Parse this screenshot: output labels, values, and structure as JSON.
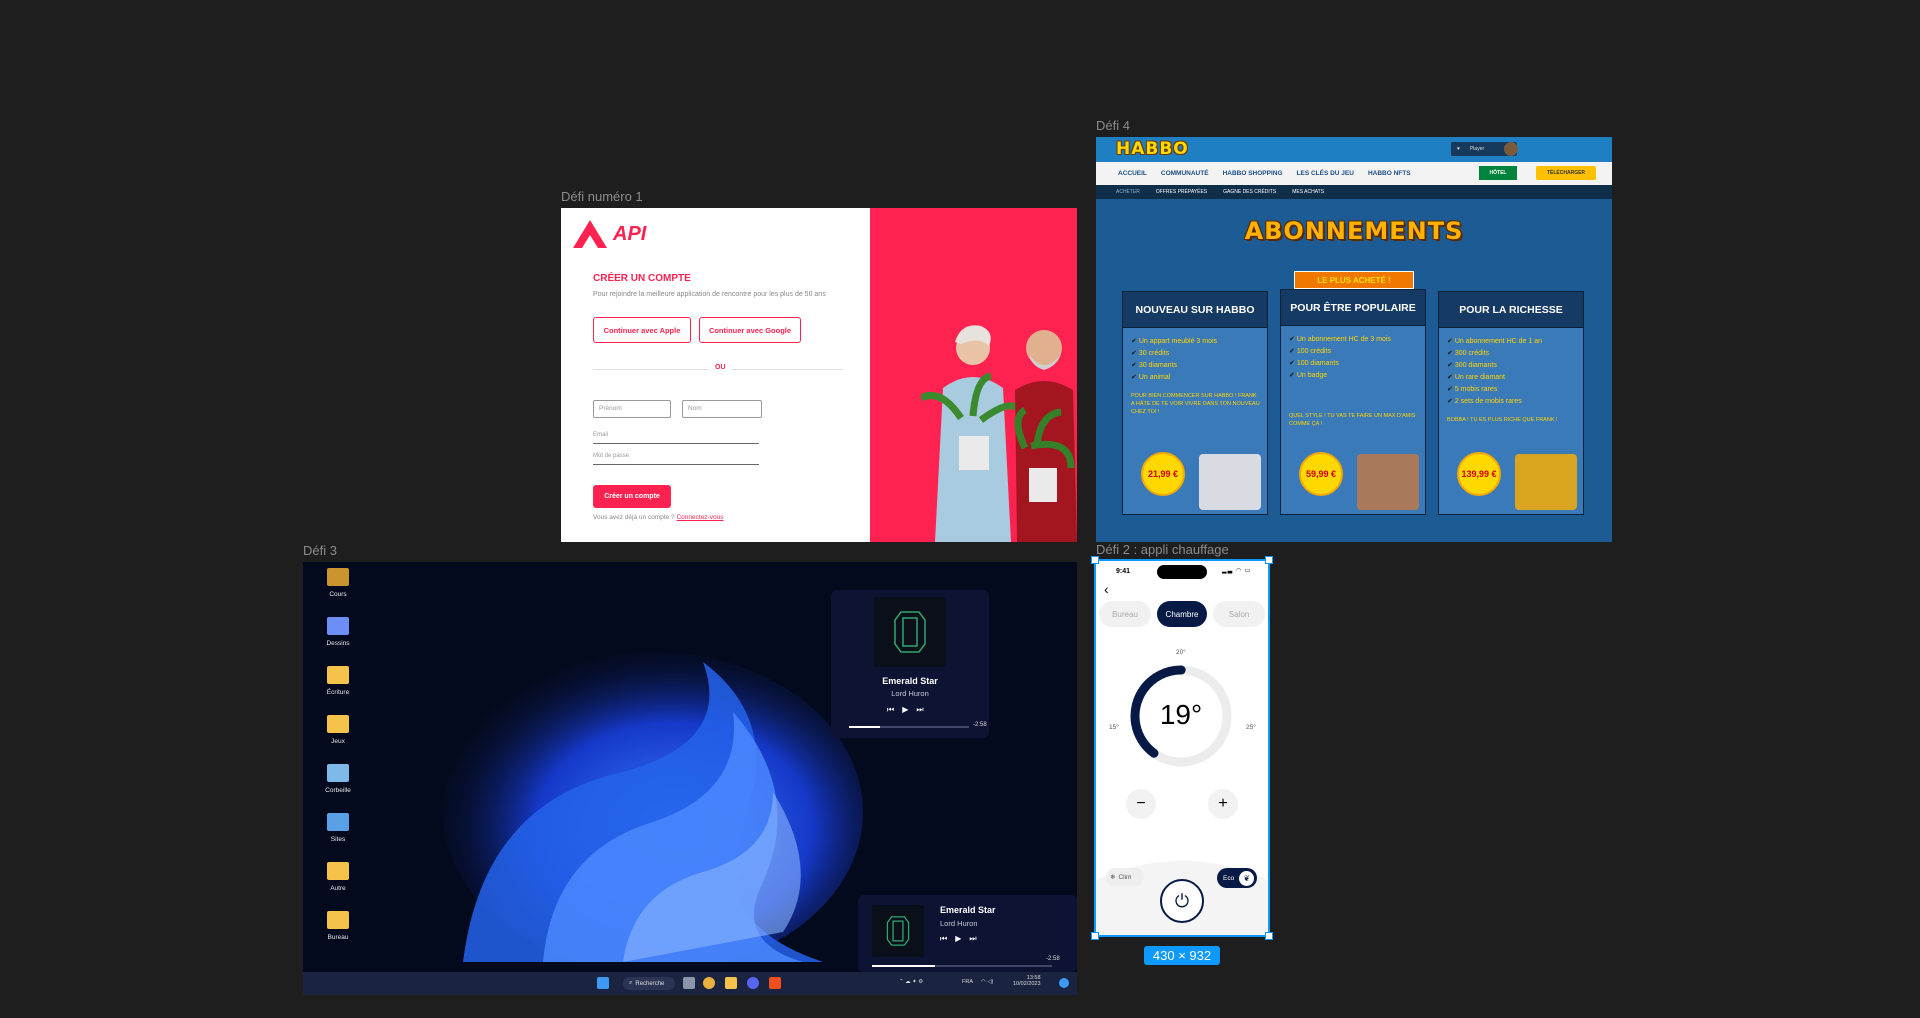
{
  "canvas": {
    "frames": {
      "defi1": {
        "label": "Défi numéro 1"
      },
      "defi4": {
        "label": "Défi 4"
      },
      "defi3": {
        "label": "Défi 3"
      },
      "defi2": {
        "label": "Défi 2 : appli chauffage"
      }
    },
    "selection_size_label": "430 × 932"
  },
  "defi1": {
    "logo": "API",
    "title": "CRÉER UN COMPTE",
    "subtitle": "Pour rejoindre la meilleure application de rencontre pour les plus de 50 ans",
    "apple_button": "Continuer avec Apple",
    "google_button": "Continuer avec Google",
    "divider_text": "OU",
    "firstname_placeholder": "Prénom",
    "lastname_placeholder": "Nom",
    "email_label": "Email",
    "password_label": "Mot de passe",
    "create_button": "Créer un compte",
    "have_account": "Vous avez déjà un compte ?",
    "login_link": "Connectez-vous",
    "accent_color": "#fe2251"
  },
  "defi4": {
    "logo": "HABBO",
    "user": "Player",
    "nav": [
      "ACCUEIL",
      "COMMUNAUTÉ",
      "HABBO SHOPPING",
      "LES CLÉS DU JEU",
      "HABBO NFTS"
    ],
    "hotel_button": "HÔTEL",
    "download_button": "TÉLÉCHARGER",
    "subnav": [
      "ACHETER",
      "OFFRES PRÉPAYÉES",
      "GAGNE DES CRÉDITS",
      "MES ACHATS"
    ],
    "heading": "ABONNEMENTS",
    "best_badge": "LE PLUS ACHETÉ !",
    "cards": [
      {
        "title": "NOUVEAU SUR HABBO",
        "items": [
          "Un appart meublé 3 mois",
          "30 crédits",
          "30 diamants",
          "Un animal"
        ],
        "blurb": "POUR BIEN COMMENCER SUR HABBO ! FRANK A HÂTE DE TE VOIR VIVRE DANS TON NOUVEAU CHEZ TOI !",
        "price": "21,99 €"
      },
      {
        "title": "POUR ÊTRE POPULAIRE",
        "items": [
          "Un abonnement HC de 3 mois",
          "100 crédits",
          "100 diamants",
          "Un badge"
        ],
        "blurb": "QUEL STYLE ! TU VAS TE FAIRE UN MAX D'AMIS COMME ÇA !",
        "price": "59,99 €"
      },
      {
        "title": "POUR LA RICHESSE",
        "items": [
          "Un abonnement HC de 1 an",
          "300 crédits",
          "300 diamants",
          "Un rare diamant",
          "5 mobis rares",
          "2 sets de mobis rares"
        ],
        "blurb": "BOBBA ! TU ES PLUS RICHE QUE FRANK !",
        "price": "139,99 €"
      }
    ]
  },
  "defi3": {
    "desktop_icons": [
      {
        "label": "Cours",
        "color": "#c9952c"
      },
      {
        "label": "Dessins",
        "color": "#6d8df7"
      },
      {
        "label": "Écriture",
        "color": "#f6c34a"
      },
      {
        "label": "Jeux",
        "color": "#f6c34a"
      },
      {
        "label": "Corbeille",
        "color": "#7fb9e8"
      },
      {
        "label": "Sites",
        "color": "#5aa0e6"
      },
      {
        "label": "Autre",
        "color": "#f6c34a"
      },
      {
        "label": "Bureau",
        "color": "#f6c34a"
      }
    ],
    "player_large": {
      "title": "Emerald Star",
      "artist": "Lord Huron",
      "time": "-2:58",
      "progress": 0.26
    },
    "player_small": {
      "title": "Emerald Star",
      "artist": "Lord Huron",
      "time": "-2:58",
      "progress": 0.35
    },
    "taskbar": {
      "search": "Recherche",
      "lang": "FRA",
      "time": "13:58",
      "date": "10/02/2023"
    }
  },
  "defi2": {
    "status_time": "9:41",
    "rooms": [
      "Bureau",
      "Chambre",
      "Salon"
    ],
    "active_room": "Chambre",
    "temperature": "19°",
    "target_label": "20°",
    "min_label": "15°",
    "max_label": "25°",
    "dial_level": 0.4,
    "minus": "−",
    "plus": "+",
    "clim_label": "Clim",
    "eco_label": "Eco",
    "theme_color": "#071a45"
  }
}
